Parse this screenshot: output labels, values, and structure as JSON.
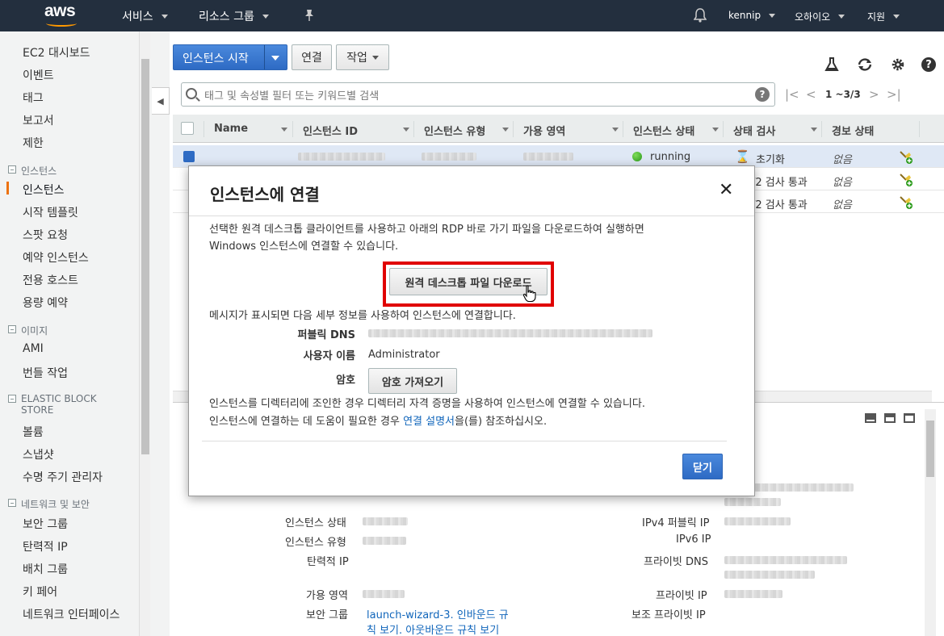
{
  "topnav": {
    "logo": "aws",
    "services": "서비스",
    "resource_groups": "리소스 그룹",
    "pin_icon": "pin-icon",
    "bell_icon": "bell-icon",
    "user": "kennip",
    "region": "오하이오",
    "support": "지원"
  },
  "sidebar": {
    "items_top": [
      "EC2 대시보드",
      "이벤트",
      "태그",
      "보고서",
      "제한"
    ],
    "section_instances": "인스턴스",
    "instances_items": [
      "인스턴스",
      "시작 템플릿",
      "스팟 요청",
      "예약 인스턴스",
      "전용 호스트",
      "용량 예약"
    ],
    "section_images": "이미지",
    "images_items": [
      "AMI",
      "번들 작업"
    ],
    "section_ebs_1": "ELASTIC BLOCK",
    "section_ebs_2": "STORE",
    "ebs_items": [
      "볼륨",
      "스냅샷",
      "수명 주기 관리자"
    ],
    "section_network": "네트워크 및 보안",
    "network_items": [
      "보안 그룹",
      "탄력적 IP",
      "배치 그룹",
      "키 페어",
      "네트워크 인터페이스"
    ]
  },
  "toolbar": {
    "launch": "인스턴스 시작",
    "connect": "연결",
    "actions": "작업"
  },
  "search": {
    "placeholder": "태그 및 속성별 필터 또는 키워드별 검색",
    "help": "?",
    "page_info": "1 ~3/3"
  },
  "table": {
    "columns": [
      "Name",
      "인스턴스 ID",
      "인스턴스 유형",
      "가용 영역",
      "인스턴스 상태",
      "상태 검사",
      "경보 상태"
    ],
    "rows": [
      {
        "state": "running",
        "check": "초기화",
        "alarm": "없음"
      },
      {
        "check": "/2 검사 통과",
        "alarm": "없음"
      },
      {
        "check": "/2 검사 통과",
        "alarm": "없음"
      }
    ]
  },
  "details": {
    "left_labels": [
      "인스턴스 상태",
      "인스턴스 유형",
      "탄력적 IP",
      "가용 영역",
      "보안 그룹"
    ],
    "security_link_1": "launch-wizard-3. 인바운드 규",
    "security_link_2": "칙 보기. 아웃바운드 규칙 보기",
    "right_labels": [
      "IPv4 퍼블릭 IP",
      "IPv6 IP",
      "프라이빗 DNS",
      "프라이빗 IP",
      "보조 프라이빗 IP"
    ]
  },
  "modal": {
    "title": "인스턴스에 연결",
    "intro_1": "선택한 원격 데스크톱 클라이언트를 사용하고 아래의 RDP 바로 가기 파일을 다운로드하여 실행하면",
    "intro_2": "Windows 인스턴스에 연결할 수 있습니다.",
    "download_button": "원격 데스크톱 파일 다운로드",
    "prompt": "메시지가 표시되면 다음 세부 정보를 사용하여 인스턴스에 연결합니다.",
    "public_dns_label": "퍼블릭 DNS",
    "username_label": "사용자 이름",
    "username_value": "Administrator",
    "password_label": "암호",
    "get_password_button": "암호 가져오기",
    "domain_note": "인스턴스를 디렉터리에 조인한 경우 디렉터리 자격 증명을 사용하여 인스턴스에 연결할 수 있습니다.",
    "help_prefix": "인스턴스에 연결하는 데 도움이 필요한 경우 ",
    "help_link": "연결 설명서",
    "help_suffix": "을(를) 참조하십시오.",
    "close_button": "닫기"
  }
}
